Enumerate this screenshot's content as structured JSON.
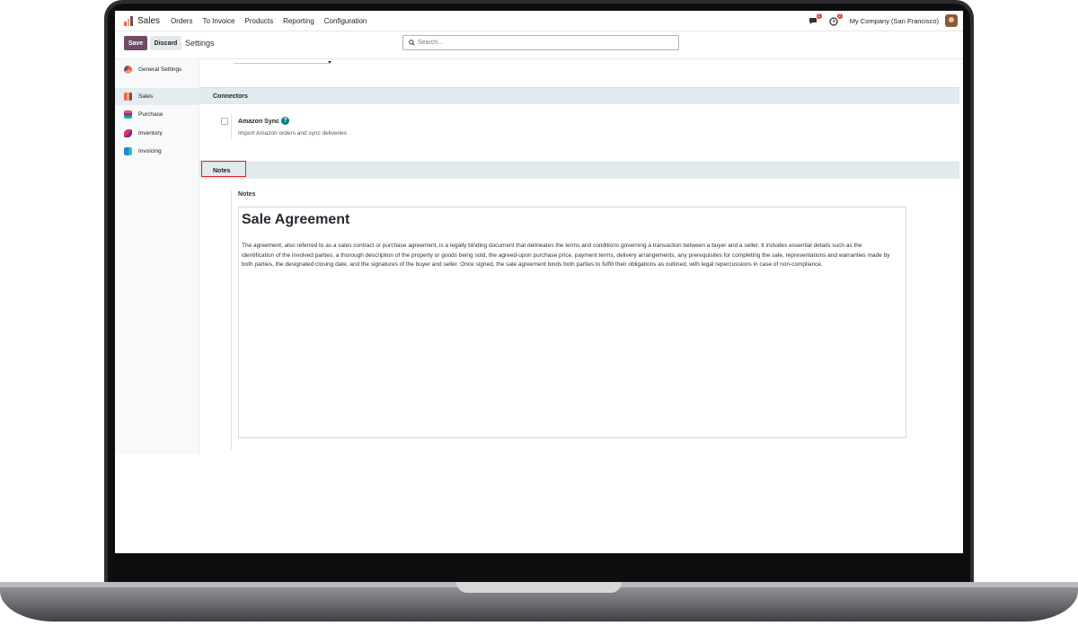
{
  "navbar": {
    "app_name": "Sales",
    "menu": [
      "Orders",
      "To Invoice",
      "Products",
      "Reporting",
      "Configuration"
    ],
    "messages_badge": "1",
    "activities_badge": "2",
    "company": "My Company (San Francisco)"
  },
  "control": {
    "save_label": "Save",
    "discard_label": "Discard",
    "title": "Settings",
    "search_placeholder": "Search..."
  },
  "sidebar": {
    "items": [
      {
        "label": "General Settings",
        "icon": "general-settings-icon",
        "color": "#f06050"
      },
      {
        "label": "Sales",
        "icon": "sales-icon",
        "color": "#f4a261",
        "active": true
      },
      {
        "label": "Purchase",
        "icon": "purchase-icon",
        "color": "#5c4b8a"
      },
      {
        "label": "Inventory",
        "icon": "inventory-icon",
        "color": "#e0356f"
      },
      {
        "label": "Invoicing",
        "icon": "invoicing-icon",
        "color": "#1e88d9"
      }
    ]
  },
  "sections": {
    "connectors": "Connectors",
    "notes": "Notes"
  },
  "amazon": {
    "label": "Amazon Sync",
    "description": "Import Amazon orders and sync deliveries",
    "checked": false
  },
  "notes": {
    "field_label": "Notes",
    "heading": "Sale Agreement",
    "body": "The agreement, also referred to as a sales contract or purchase agreement, is a legally binding document that delineates the terms and conditions governing a transaction between a buyer and a seller. It includes essential details such as the identification of the involved parties, a thorough description of the property or goods being sold, the agreed-upon purchase price, payment terms, delivery arrangements, any prerequisites for completing the sale, representations and warranties made by both parties, the designated closing date, and the signatures of the buyer and seller. Once signed, the sale agreement binds both parties to fulfill their obligations as outlined, with legal repercussions in case of non-compliance."
  },
  "colors": {
    "brand": "#714b67",
    "section_bg": "#e1eaec",
    "highlight": "#e02020",
    "help": "#017e84"
  }
}
